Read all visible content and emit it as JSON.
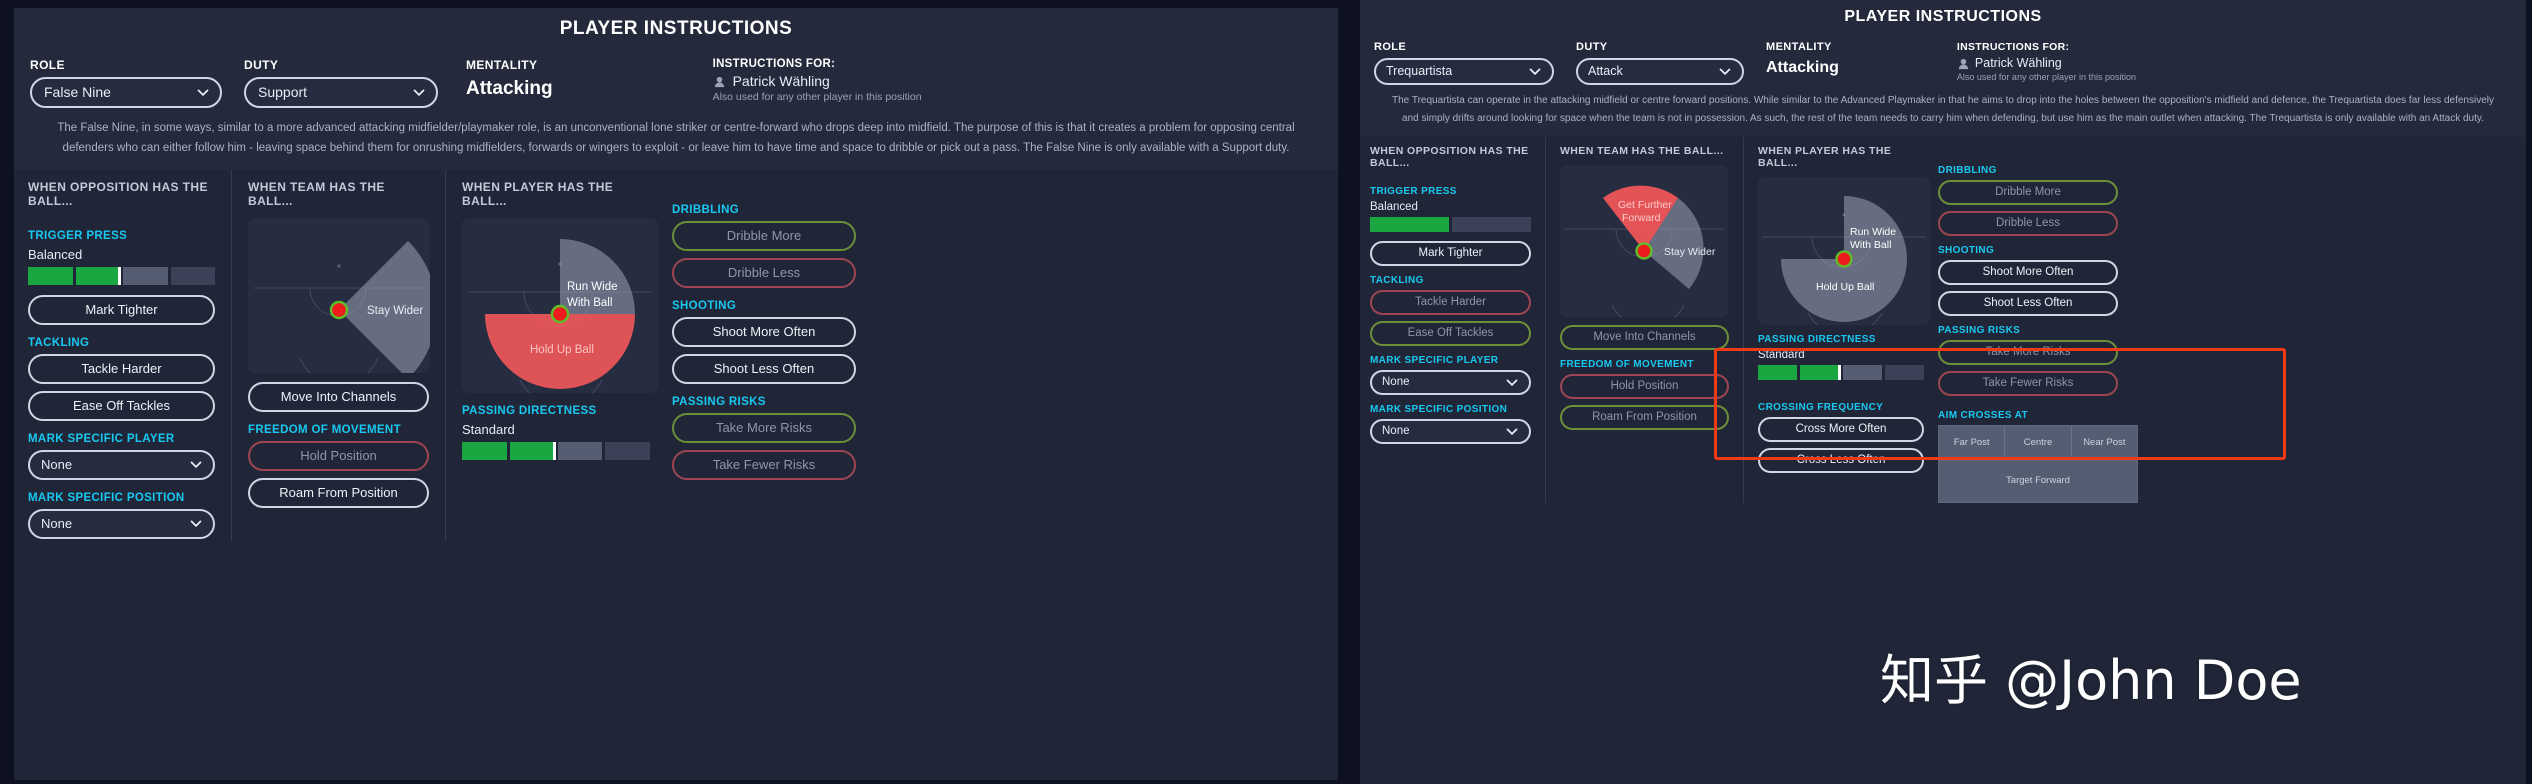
{
  "left": {
    "title": "PLAYER INSTRUCTIONS",
    "role_label": "ROLE",
    "role_value": "False Nine",
    "duty_label": "DUTY",
    "duty_value": "Support",
    "mentality_label": "MENTALITY",
    "mentality_value": "Attacking",
    "instructions_for_label": "INSTRUCTIONS FOR:",
    "player_name": "Patrick Wähling",
    "instructions_note": "Also used for any other player in this position",
    "role_description": "The False Nine, in some ways, similar to a more advanced attacking midfielder/playmaker role, is an unconventional lone striker or centre-forward who drops deep into midfield. The purpose of this is that it creates a problem for opposing central defenders who can either follow him - leaving space behind them for onrushing midfielders, forwards or wingers to exploit - or leave him to have time and space to dribble or pick out a pass. The False Nine is only available with a Support duty.",
    "col1": {
      "title": "WHEN OPPOSITION HAS THE BALL...",
      "trigger_press_label": "TRIGGER PRESS",
      "trigger_press_value": "Balanced",
      "mark_tighter": "Mark Tighter",
      "tackling_label": "TACKLING",
      "tackle_harder": "Tackle Harder",
      "ease_off_tackles": "Ease Off Tackles",
      "mark_player_label": "MARK SPECIFIC PLAYER",
      "mark_player_value": "None",
      "mark_position_label": "MARK SPECIFIC POSITION",
      "mark_position_value": "None"
    },
    "col2": {
      "title": "WHEN TEAM HAS THE BALL...",
      "pitch_labels": [
        "Stay Wider"
      ],
      "move_into_channels": "Move Into Channels",
      "freedom_label": "FREEDOM OF MOVEMENT",
      "hold_position": "Hold Position",
      "roam_from_position": "Roam From Position"
    },
    "col3": {
      "title": "WHEN PLAYER HAS THE BALL...",
      "pitch_labels": [
        "Run Wide",
        "With Ball",
        "Hold Up Ball"
      ],
      "passing_directness_label": "PASSING DIRECTNESS",
      "passing_directness_value": "Standard"
    },
    "col4": {
      "dribbling_label": "DRIBBLING",
      "dribble_more": "Dribble More",
      "dribble_less": "Dribble Less",
      "shooting_label": "SHOOTING",
      "shoot_more": "Shoot More Often",
      "shoot_less": "Shoot Less Often",
      "passing_risks_label": "PASSING RISKS",
      "take_more_risks": "Take More Risks",
      "take_fewer_risks": "Take Fewer Risks"
    }
  },
  "right": {
    "title": "PLAYER INSTRUCTIONS",
    "role_label": "ROLE",
    "role_value": "Trequartista",
    "duty_label": "DUTY",
    "duty_value": "Attack",
    "mentality_label": "MENTALITY",
    "mentality_value": "Attacking",
    "instructions_for_label": "INSTRUCTIONS FOR:",
    "player_name": "Patrick Wähling",
    "instructions_note": "Also used for any other player in this position",
    "role_description": "The Trequartista can operate in the attacking midfield or centre forward positions. While similar to the Advanced Playmaker in that he aims to drop into the holes between the opposition's midfield and defence, the Trequartista does far less defensively and simply drifts around looking for space when the team is not in possession. As such, the rest of the team needs to carry him when defending, but use him as the main outlet when attacking. The Trequartista is only available with an Attack duty.",
    "col1": {
      "title": "WHEN OPPOSITION HAS THE BALL...",
      "trigger_press_label": "TRIGGER PRESS",
      "trigger_press_value": "Balanced",
      "mark_tighter": "Mark Tighter",
      "tackling_label": "TACKLING",
      "tackle_harder": "Tackle Harder",
      "ease_off_tackles": "Ease Off Tackles",
      "mark_player_label": "MARK SPECIFIC PLAYER",
      "mark_player_value": "None",
      "mark_position_label": "MARK SPECIFIC POSITION",
      "mark_position_value": "None"
    },
    "col2": {
      "title": "WHEN TEAM HAS THE BALL...",
      "pitch_labels": [
        "Get Further",
        "Forward",
        "Stay Wider"
      ],
      "move_into_channels": "Move Into Channels",
      "freedom_label": "FREEDOM OF MOVEMENT",
      "hold_position": "Hold Position",
      "roam_from_position": "Roam From Position"
    },
    "col3": {
      "title": "WHEN PLAYER HAS THE BALL...",
      "pitch_labels": [
        "Run Wide",
        "With Ball",
        "Hold Up Ball"
      ],
      "passing_directness_label": "PASSING DIRECTNESS",
      "passing_directness_value": "Standard",
      "crossing_frequency_label": "CROSSING FREQUENCY",
      "cross_more_often": "Cross More Often",
      "cross_less_often": "Cross Less Often"
    },
    "col4": {
      "dribbling_label": "DRIBBLING",
      "dribble_more": "Dribble More",
      "dribble_less": "Dribble Less",
      "shooting_label": "SHOOTING",
      "shoot_more": "Shoot More Often",
      "shoot_less": "Shoot Less Often",
      "passing_risks_label": "PASSING RISKS",
      "take_more_risks": "Take More Risks",
      "take_fewer_risks": "Take Fewer Risks",
      "aim_crosses_label": "AIM CROSSES AT",
      "aim_cells": [
        "Far Post",
        "Centre",
        "Near Post"
      ],
      "aim_row2": "Target Forward"
    }
  },
  "watermark": "知乎 @John Doe",
  "colors": {
    "accent_cyan": "#18c8f0",
    "green": "#1aa640",
    "red_highlight": "#f03a17",
    "red_sector": "#ff5a5a",
    "panel_bg": "#202637",
    "header_bg": "#242a3c"
  }
}
